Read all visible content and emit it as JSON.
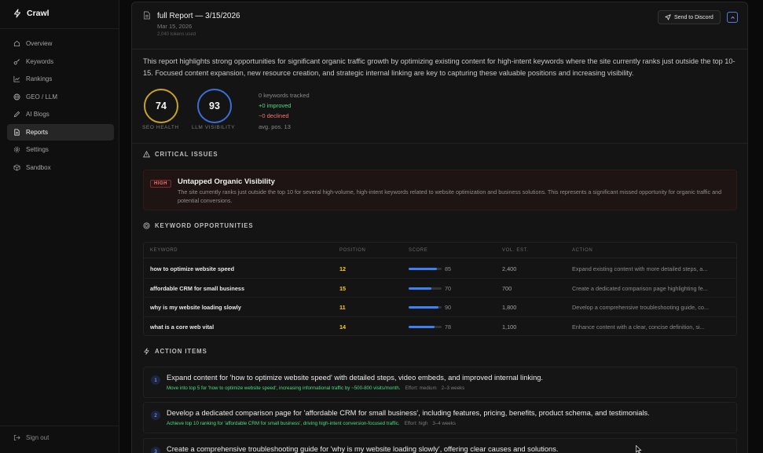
{
  "app": {
    "name": "Crawl"
  },
  "sidebar": {
    "items": [
      {
        "label": "Overview",
        "icon": "home-icon"
      },
      {
        "label": "Keywords",
        "icon": "key-icon"
      },
      {
        "label": "Rankings",
        "icon": "chart-icon"
      },
      {
        "label": "GEO / LLM",
        "icon": "globe-icon"
      },
      {
        "label": "AI Blogs",
        "icon": "pen-icon"
      },
      {
        "label": "Reports",
        "icon": "document-icon",
        "active": true
      },
      {
        "label": "Settings",
        "icon": "gear-icon"
      },
      {
        "label": "Sandbox",
        "icon": "box-icon"
      }
    ],
    "signout": "Sign out"
  },
  "report": {
    "title": "full Report — 3/15/2026",
    "date": "Mar 15, 2026",
    "tokens": "2,040 tokens used",
    "send_label": "Send to Discord",
    "summary": "This report highlights strong opportunities for significant organic traffic growth by optimizing existing content for high-intent keywords where the site currently ranks just outside the top 10-15. Focused content expansion, new resource creation, and strategic internal linking are key to capturing these valuable positions and increasing visibility.",
    "seo_health": {
      "value": "74",
      "label": "SEO HEALTH",
      "color": "#c9a227"
    },
    "llm_visibility": {
      "value": "93",
      "label": "LLM VISIBILITY",
      "color": "#3b6fd8"
    },
    "stats": {
      "tracked": "0 keywords tracked",
      "improved": "+0 improved",
      "declined": "−0 declined",
      "avg": "avg. pos. 13"
    }
  },
  "critical": {
    "title": "CRITICAL ISSUES",
    "issues": [
      {
        "badge": "HIGH",
        "title": "Untapped Organic Visibility",
        "desc": "The site currently ranks just outside the top 10 for several high-volume, high-intent keywords related to website optimization and business solutions. This represents a significant missed opportunity for organic traffic and potential conversions."
      }
    ]
  },
  "keywords": {
    "title": "KEYWORD OPPORTUNITIES",
    "headers": {
      "keyword": "KEYWORD",
      "position": "POSITION",
      "score": "SCORE",
      "volume": "VOL. EST.",
      "action": "ACTION"
    },
    "rows": [
      {
        "keyword": "how to optimize website speed",
        "position": "12",
        "score": 85,
        "score_label": "85",
        "volume": "2,400",
        "action": "Expand existing content with more detailed steps, a..."
      },
      {
        "keyword": "affordable CRM for small business",
        "position": "15",
        "score": 70,
        "score_label": "70",
        "volume": "700",
        "action": "Create a dedicated comparison page highlighting fe..."
      },
      {
        "keyword": "why is my website loading slowly",
        "position": "11",
        "score": 90,
        "score_label": "90",
        "volume": "1,800",
        "action": "Develop a comprehensive troubleshooting guide, co..."
      },
      {
        "keyword": "what is a core web vital",
        "position": "14",
        "score": 78,
        "score_label": "78",
        "volume": "1,100",
        "action": "Enhance content with a clear, concise definition, si..."
      }
    ]
  },
  "actions": {
    "title": "ACTION ITEMS",
    "items": [
      {
        "num": "1",
        "title": "Expand content for 'how to optimize website speed' with detailed steps, video embeds, and improved internal linking.",
        "goal": "Move into top 5 for 'how to optimize website speed', increasing informational traffic by ~500-800 visits/month.",
        "effort": "Effort: medium",
        "time": "2–3 weeks"
      },
      {
        "num": "2",
        "title": "Develop a dedicated comparison page for 'affordable CRM for small business', including features, pricing, benefits, product schema, and testimonials.",
        "goal": "Achieve top 10 ranking for 'affordable CRM for small business', driving high-intent conversion-focused traffic.",
        "effort": "Effort: high",
        "time": "3–4 weeks"
      },
      {
        "num": "3",
        "title": "Create a comprehensive troubleshooting guide for 'why is my website loading slowly', offering clear causes and solutions.",
        "goal": "",
        "effort": "",
        "time": ""
      }
    ]
  }
}
